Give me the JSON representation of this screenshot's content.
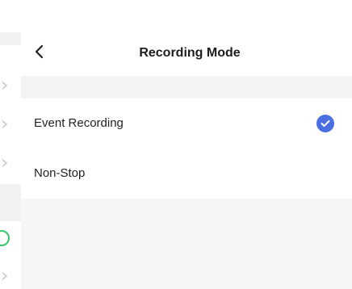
{
  "header": {
    "title": "Recording Mode",
    "back_icon": "chevron-left-icon"
  },
  "options": [
    {
      "label": "Event Recording",
      "selected": true
    },
    {
      "label": "Non-Stop",
      "selected": false
    }
  ],
  "colors": {
    "accent": "#4b6fe0",
    "background": "#f6f6f6",
    "surface": "#ffffff",
    "underlay_indicator": "#3cc46a"
  }
}
